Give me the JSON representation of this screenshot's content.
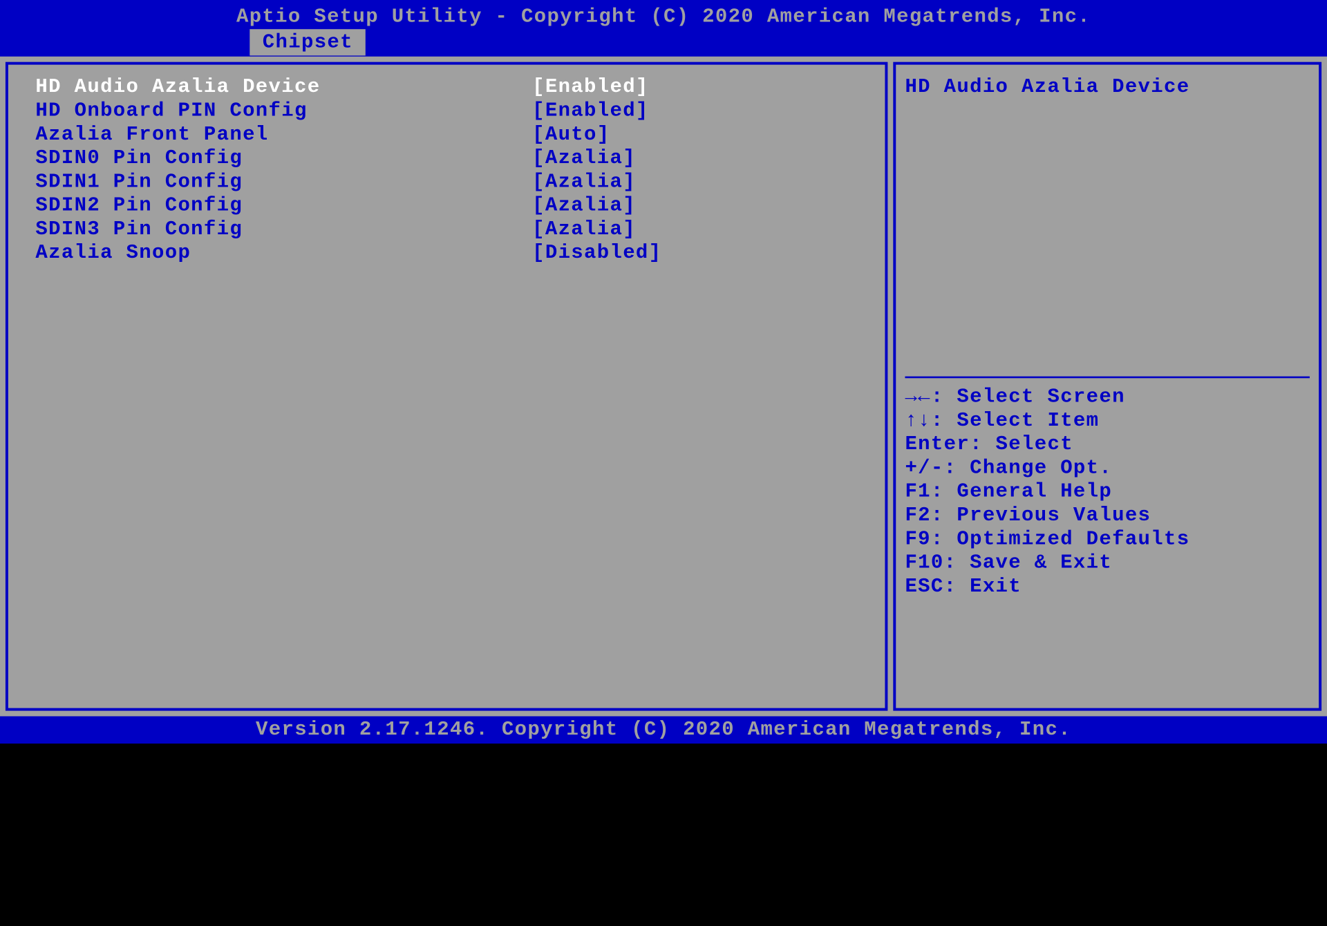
{
  "header": {
    "title": "Aptio Setup Utility - Copyright (C) 2020 American Megatrends, Inc.",
    "active_tab": "Chipset"
  },
  "settings": [
    {
      "label": "HD Audio Azalia Device",
      "value": "[Enabled]",
      "selected": true
    },
    {
      "label": "HD Onboard PIN Config",
      "value": "[Enabled]",
      "selected": false
    },
    {
      "label": "Azalia Front Panel",
      "value": "[Auto]",
      "selected": false
    },
    {
      "label": "SDIN0 Pin Config",
      "value": "[Azalia]",
      "selected": false
    },
    {
      "label": "SDIN1 Pin Config",
      "value": "[Azalia]",
      "selected": false
    },
    {
      "label": "SDIN2 Pin Config",
      "value": "[Azalia]",
      "selected": false
    },
    {
      "label": "SDIN3 Pin Config",
      "value": "[Azalia]",
      "selected": false
    },
    {
      "label": "Azalia Snoop",
      "value": "[Disabled]",
      "selected": false
    }
  ],
  "help": {
    "title": "HD Audio Azalia Device",
    "keys": [
      "→←: Select Screen",
      "↑↓: Select Item",
      "Enter: Select",
      "+/-: Change Opt.",
      "F1: General Help",
      "F2: Previous Values",
      "F9: Optimized Defaults",
      "F10: Save & Exit",
      "ESC: Exit"
    ]
  },
  "footer": {
    "version": "Version 2.17.1246. Copyright (C) 2020 American Megatrends, Inc."
  }
}
